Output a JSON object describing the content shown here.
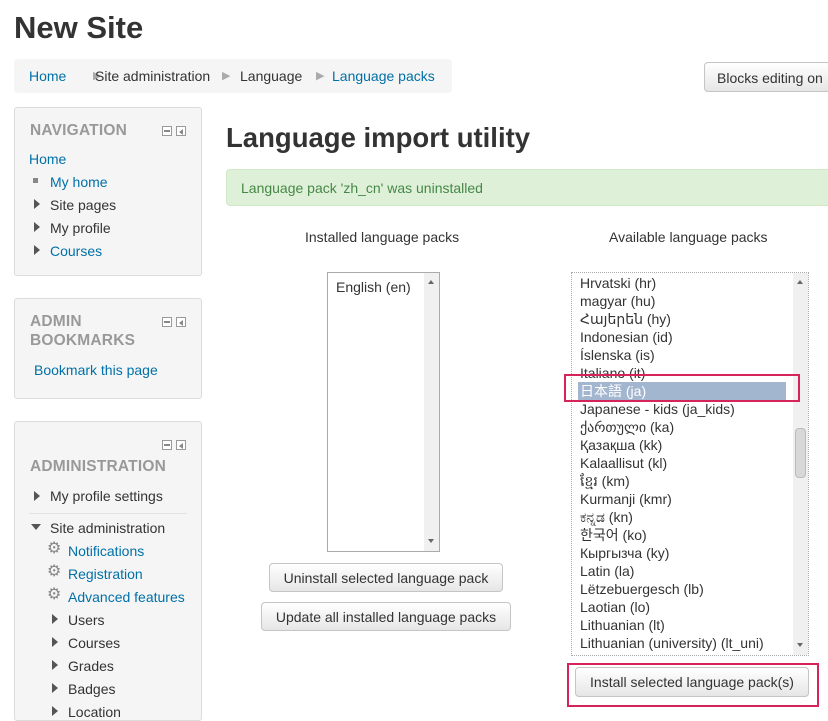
{
  "site": {
    "title": "New Site"
  },
  "breadcrumb": [
    "Home",
    "Site administration",
    "Language",
    "Language packs"
  ],
  "header": {
    "blocks_editing_label": "Blocks editing on"
  },
  "navigation": {
    "title": "NAVIGATION",
    "home": "Home",
    "items": [
      "My home",
      "Site pages",
      "My profile",
      "Courses"
    ]
  },
  "bookmarks": {
    "title_line1": "ADMIN",
    "title_line2": "BOOKMARKS",
    "link": "Bookmark this page"
  },
  "administration": {
    "title": "ADMINISTRATION",
    "my_profile_settings": "My profile settings",
    "site_administration": "Site administration",
    "items": [
      "Notifications",
      "Registration",
      "Advanced features",
      "Users",
      "Courses",
      "Grades",
      "Badges",
      "Location"
    ]
  },
  "main": {
    "title": "Language import utility",
    "notice": "Language pack 'zh_cn' was uninstalled",
    "installed_heading": "Installed language packs",
    "available_heading": "Available language packs",
    "installed": [
      "English (en)"
    ],
    "available": [
      "Hrvatski (hr)",
      "magyar (hu)",
      "Հայերեն (hy)",
      "Indonesian (id)",
      "Íslenska (is)",
      "Italiano (it)",
      "日本語 (ja)",
      "Japanese - kids (ja_kids)",
      "ქართული (ka)",
      "Қазақша (kk)",
      "Kalaallisut (kl)",
      "ខ្មែរ (km)",
      "Kurmanji (kmr)",
      "ಕನ್ನಡ (kn)",
      "한국어 (ko)",
      "Кыргызча (ky)",
      "Latin (la)",
      "Lëtzebuergesch (lb)",
      "Laotian (lo)",
      "Lithuanian (lt)",
      "Lithuanian (university) (lt_uni)"
    ],
    "selected_available": "日本語 (ja)",
    "uninstall_button": "Uninstall selected language pack",
    "update_button": "Update all installed language packs",
    "install_button": "Install selected language pack(s)"
  },
  "colors": {
    "link": "#0070a8",
    "notice_bg": "#dff0d8",
    "notice_text": "#468847",
    "highlight": "#d6245a",
    "selection": "#a3b6cf"
  }
}
